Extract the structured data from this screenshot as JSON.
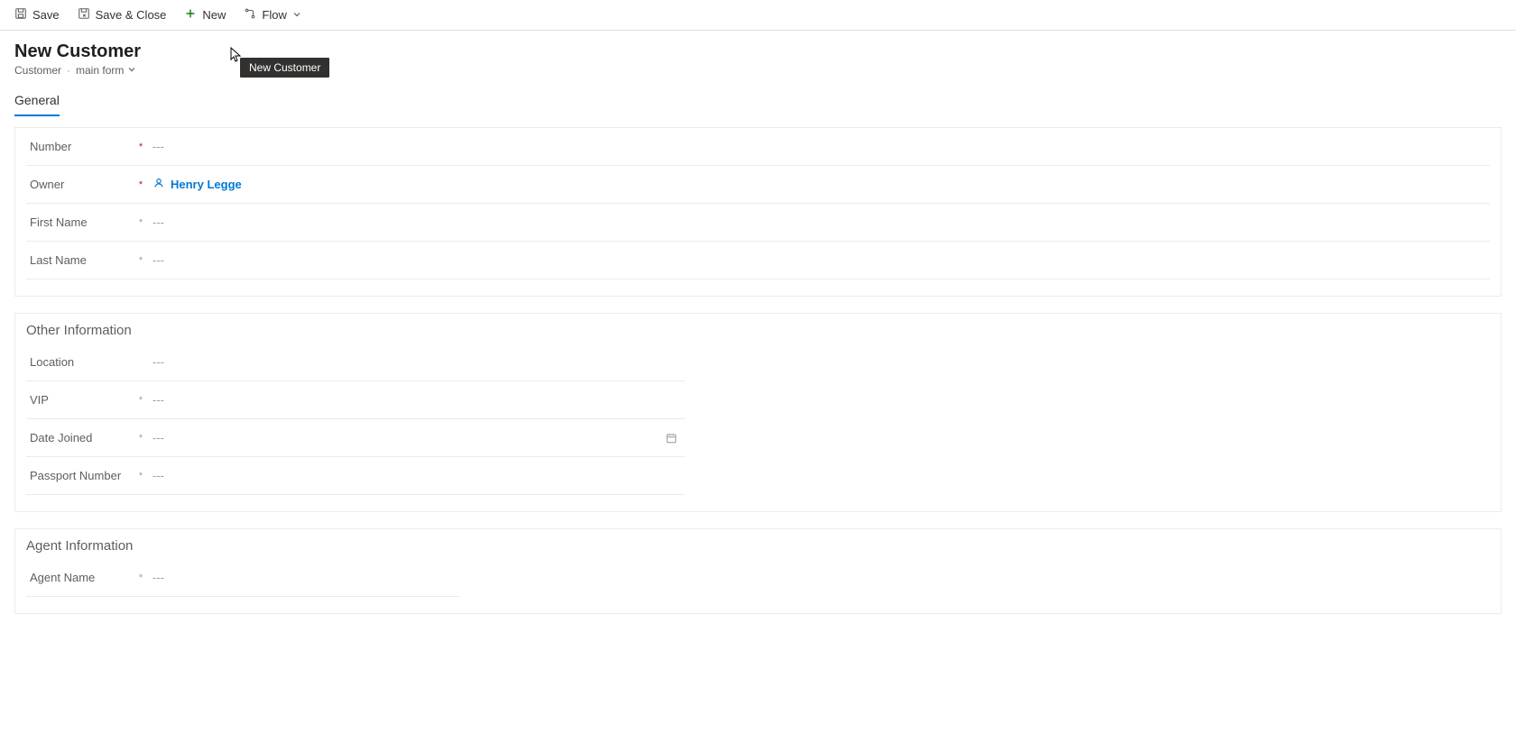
{
  "cmdbar": {
    "save": "Save",
    "save_close": "Save & Close",
    "new": "New",
    "flow": "Flow"
  },
  "header": {
    "title": "New Customer",
    "entity": "Customer",
    "form_name": "main form",
    "tooltip": "New Customer"
  },
  "tabs": {
    "general": "General"
  },
  "sections": {
    "main": {
      "fields": {
        "number": {
          "label": "Number",
          "value": "---",
          "required": "*"
        },
        "owner": {
          "label": "Owner",
          "value": "Henry Legge",
          "required": "*"
        },
        "first_name": {
          "label": "First Name",
          "value": "---",
          "required": "*"
        },
        "last_name": {
          "label": "Last Name",
          "value": "---",
          "required": "*"
        }
      }
    },
    "other": {
      "title": "Other Information",
      "fields": {
        "location": {
          "label": "Location",
          "value": "---",
          "required": ""
        },
        "vip": {
          "label": "VIP",
          "value": "---",
          "required": "*"
        },
        "date_joined": {
          "label": "Date Joined",
          "value": "---",
          "required": "*"
        },
        "passport_number": {
          "label": "Passport Number",
          "value": "---",
          "required": "*"
        }
      }
    },
    "agent": {
      "title": "Agent Information",
      "fields": {
        "agent_name": {
          "label": "Agent Name",
          "value": "---",
          "required": "*"
        }
      }
    }
  }
}
